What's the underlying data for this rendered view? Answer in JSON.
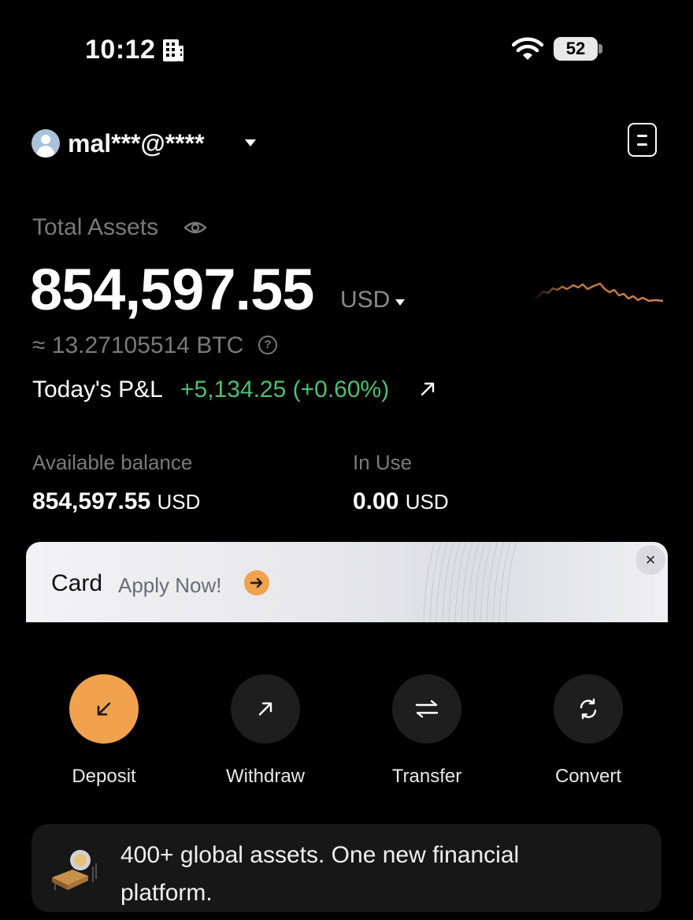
{
  "status_bar": {
    "time": "10:12",
    "battery": "52"
  },
  "account": {
    "name": "mal***@****"
  },
  "assets": {
    "label": "Total Assets",
    "total": "854,597.55",
    "currency": "USD",
    "btc_equivalent": "≈ 13.27105514 BTC",
    "help_symbol": "?",
    "pnl_label": "Today's P&L",
    "pnl_value": "+5,134.25 (+0.60%)",
    "pnl_color": "#4fbf72",
    "sparkline_color": "#d5834a"
  },
  "balances": {
    "available_label": "Available balance",
    "available_amount": "854,597.55",
    "available_unit": "USD",
    "in_use_label": "In Use",
    "in_use_amount": "0.00",
    "in_use_unit": "USD"
  },
  "banner": {
    "title": "Card",
    "cta": "Apply Now!",
    "close_symbol": "×",
    "accent": "#f0a24d"
  },
  "actions": [
    {
      "label": "Deposit",
      "icon": "arrow-down-left-icon"
    },
    {
      "label": "Withdraw",
      "icon": "arrow-up-right-icon"
    },
    {
      "label": "Transfer",
      "icon": "transfer-icon"
    },
    {
      "label": "Convert",
      "icon": "convert-icon"
    }
  ],
  "promo": {
    "text": "400+ global assets. One new financial platform."
  }
}
